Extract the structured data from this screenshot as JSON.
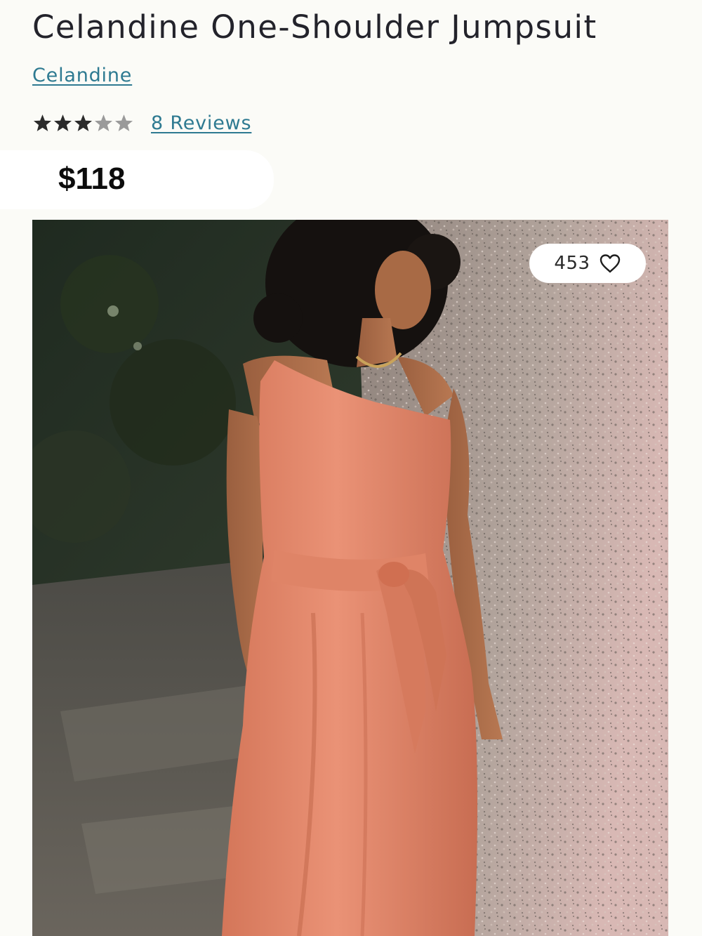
{
  "product": {
    "title": "Celandine One-Shoulder Jumpsuit",
    "brand": "Celandine",
    "rating": 3,
    "rating_max": 5,
    "reviews_label": "8 Reviews",
    "price": "$118"
  },
  "likes": {
    "count": "453",
    "icon": "heart-outline-icon"
  },
  "colors": {
    "link": "#2e7a91",
    "star_filled": "#2b2b2b",
    "star_empty": "#9a9a9a",
    "jumpsuit": "#e58a6c"
  }
}
